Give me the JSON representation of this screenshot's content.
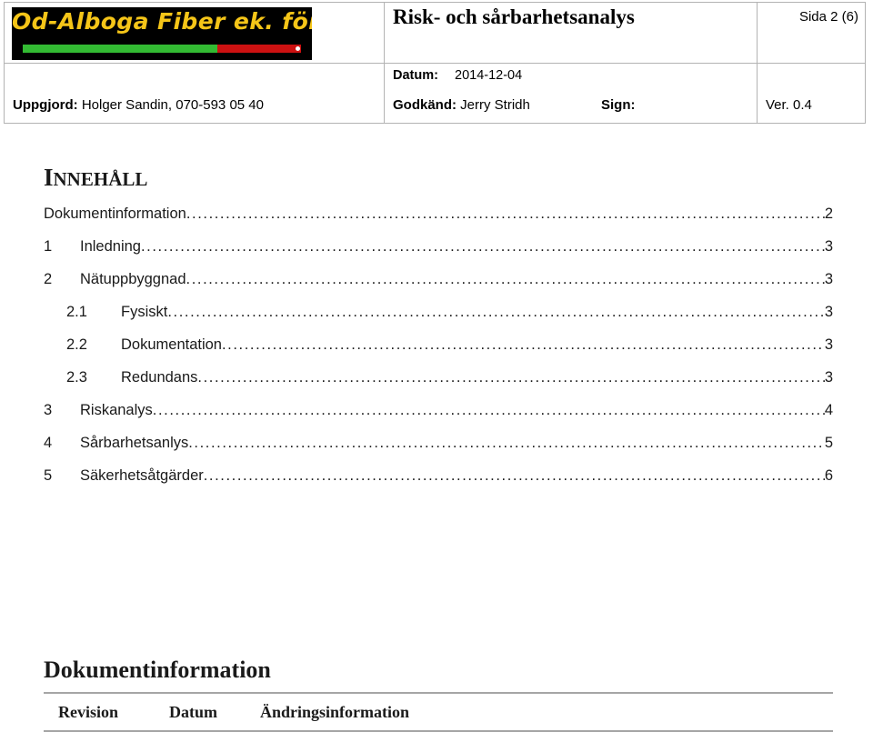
{
  "header": {
    "logo": {
      "text": "Od-Alboga Fiber ek. för.",
      "bg_color": "#000000",
      "text_color": "#f5c518",
      "bar_green": "#33bb33",
      "bar_red": "#cc1111"
    },
    "document_title": "Risk- och sårbarhetsanalys",
    "page_indicator": "Sida 2 (6)",
    "datum_label": "Datum:",
    "datum_value": "2014-12-04",
    "uppgjord_label": "Uppgjord:",
    "uppgjord_value": "Holger Sandin, 070-593 05 40",
    "godkand_label": "Godkänd:",
    "godkand_value": "Jerry Stridh",
    "sign_label": "Sign:",
    "version": "Ver. 0.4"
  },
  "toc": {
    "heading_first_letter": "I",
    "heading_rest": "NNEHÅLL",
    "leader": "...........................................................................................................................................................",
    "entries": [
      {
        "num": "",
        "label": "Dokumentinformation",
        "page": "2",
        "level": 1
      },
      {
        "num": "1",
        "label": "Inledning",
        "page": "3",
        "level": 1
      },
      {
        "num": "2",
        "label": "Nätuppbyggnad",
        "page": "3",
        "level": 1
      },
      {
        "num": "2.1",
        "label": "Fysiskt",
        "page": "3",
        "level": 2
      },
      {
        "num": "2.2",
        "label": "Dokumentation",
        "page": "3",
        "level": 2
      },
      {
        "num": "2.3",
        "label": "Redundans",
        "page": "3",
        "level": 2
      },
      {
        "num": "3",
        "label": "Riskanalys",
        "page": "4",
        "level": 1
      },
      {
        "num": "4",
        "label": "Sårbarhetsanlys",
        "page": "5",
        "level": 1
      },
      {
        "num": "5",
        "label": "Säkerhetsåtgärder",
        "page": "6",
        "level": 1
      }
    ]
  },
  "document_info": {
    "heading": "Dokumentinformation",
    "columns": [
      "Revision",
      "Datum",
      "Ändringsinformation"
    ]
  }
}
